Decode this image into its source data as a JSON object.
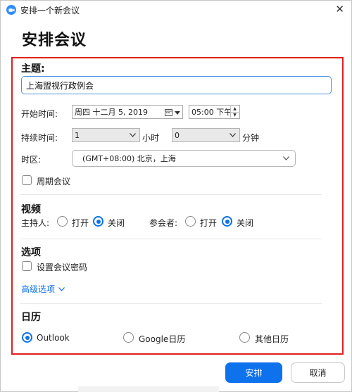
{
  "window": {
    "title": "安排一个新会议",
    "close_glyph": "✕"
  },
  "page": {
    "title": "安排会议"
  },
  "topic": {
    "label": "主题:",
    "value": "上海盟视行政例会"
  },
  "start_time": {
    "label": "开始时间:",
    "date": "周四 十二月 5, 2019",
    "time": "05:00 下午"
  },
  "duration": {
    "label": "持续时间:",
    "hours_value": "1",
    "hours_unit": "小时",
    "minutes_value": "0",
    "minutes_unit": "分钟"
  },
  "timezone": {
    "label": "时区:",
    "value": "(GMT+08:00) 北京，上海"
  },
  "recurring": {
    "label": "周期会议"
  },
  "video": {
    "heading": "视频",
    "host_label": "主持人:",
    "participants_label": "参会者:",
    "on_label": "打开",
    "off_label": "关闭"
  },
  "options": {
    "heading": "选项",
    "password_label": "设置会议密码",
    "advanced_label": "高级选项"
  },
  "calendar": {
    "heading": "日历",
    "outlook": "Outlook",
    "google": "Google日历",
    "other": "其他日历"
  },
  "buttons": {
    "schedule": "安排",
    "cancel": "取消"
  },
  "colors": {
    "accent": "#0e72ed",
    "highlight_box": "#e02020"
  },
  "icons": {
    "app": "zoom-logo-icon",
    "calendar": "calendar-icon",
    "dropdown": "chevron-down-icon"
  }
}
